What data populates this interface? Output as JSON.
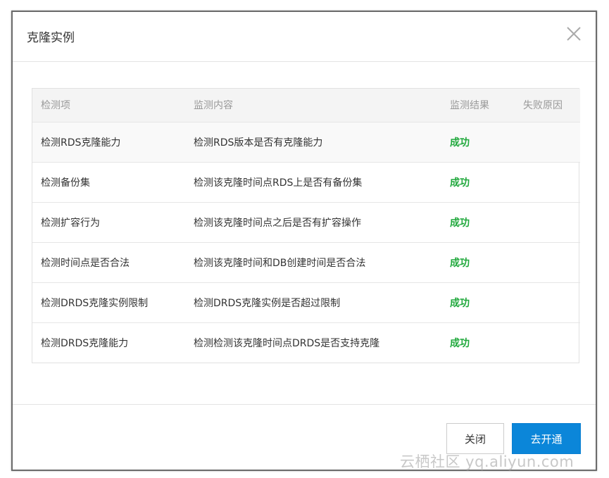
{
  "dialog": {
    "title": "克隆实例",
    "close_icon": "close-icon"
  },
  "table": {
    "headers": [
      "检测项",
      "监测内容",
      "监测结果",
      "失败原因"
    ],
    "rows": [
      {
        "item": "检测RDS克隆能力",
        "content": "检测RDS版本是否有克隆能力",
        "result": "成功",
        "reason": ""
      },
      {
        "item": "检测备份集",
        "content": "检测该克隆时间点RDS上是否有备份集",
        "result": "成功",
        "reason": ""
      },
      {
        "item": "检测扩容行为",
        "content": "检测该克隆时间点之后是否有扩容操作",
        "result": "成功",
        "reason": ""
      },
      {
        "item": "检测时间点是否合法",
        "content": "检测该克隆时间和DB创建时间是否合法",
        "result": "成功",
        "reason": ""
      },
      {
        "item": "检测DRDS克隆实例限制",
        "content": "检测DRDS克隆实例是否超过限制",
        "result": "成功",
        "reason": ""
      },
      {
        "item": "检测DRDS克隆能力",
        "content": "检测检测该克隆时间点DRDS是否支持克隆",
        "result": "成功",
        "reason": ""
      }
    ]
  },
  "footer": {
    "close_label": "关闭",
    "open_label": "去开通"
  },
  "watermark": "云栖社区 yq.aliyun.com",
  "colors": {
    "success": "#1fa83b",
    "primary": "#0b86d9"
  }
}
